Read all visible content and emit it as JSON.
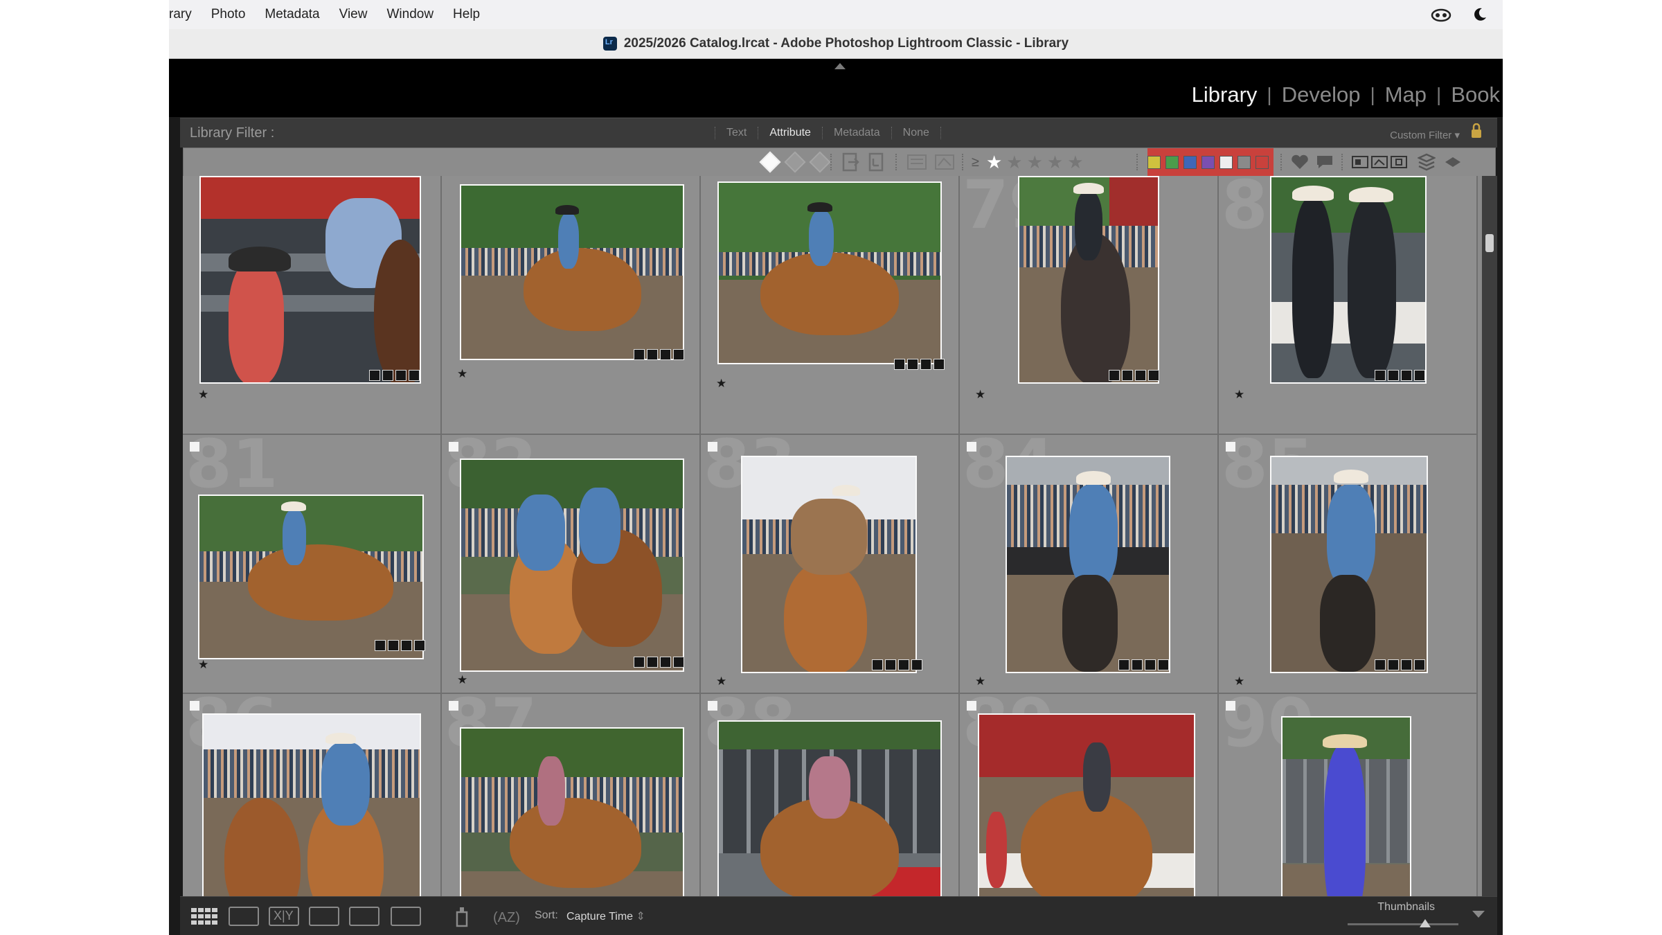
{
  "menu": {
    "items": [
      "rary",
      "Photo",
      "Metadata",
      "View",
      "Window",
      "Help"
    ],
    "icons": [
      "creative-cloud-icon",
      "moon-icon"
    ]
  },
  "window": {
    "title": "2025/2026 Catalog.lrcat - Adobe Photoshop Lightroom Classic - Library"
  },
  "modules": [
    {
      "label": "Library",
      "active": true
    },
    {
      "label": "Develop",
      "active": false
    },
    {
      "label": "Map",
      "active": false
    },
    {
      "label": "Book",
      "active": false
    }
  ],
  "filter": {
    "label": "Library Filter :",
    "tabs": [
      "Text",
      "Attribute",
      "Metadata",
      "None"
    ],
    "active_tab": "Attribute",
    "preset": "Custom Filter",
    "rating_op": "≥",
    "rating_min": 1,
    "label_colors": [
      "#c9413c",
      "#cfc23e",
      "#4b9c4b",
      "#3f67b8",
      "#7a4fb0",
      "#eeeeee",
      "#8a8a8a"
    ]
  },
  "grid": {
    "cells": [
      {
        "num": "",
        "rating": "★"
      },
      {
        "num": "",
        "rating": "★"
      },
      {
        "num": "",
        "rating": "★"
      },
      {
        "num": "79",
        "rating": "★"
      },
      {
        "num": "80",
        "rating": "★"
      },
      {
        "num": "81",
        "rating": "★"
      },
      {
        "num": "82",
        "rating": "★"
      },
      {
        "num": "83",
        "rating": "★"
      },
      {
        "num": "84",
        "rating": "★"
      },
      {
        "num": "85",
        "rating": "★"
      },
      {
        "num": "86",
        "rating": ""
      },
      {
        "num": "87",
        "rating": ""
      },
      {
        "num": "88",
        "rating": ""
      },
      {
        "num": "89",
        "rating": ""
      },
      {
        "num": "90",
        "rating": ""
      }
    ]
  },
  "toolbar": {
    "sort_label": "Sort:",
    "sort_value": "Capture Time",
    "thumbnails_label": "Thumbnails",
    "thumbnail_size": 0.7
  }
}
